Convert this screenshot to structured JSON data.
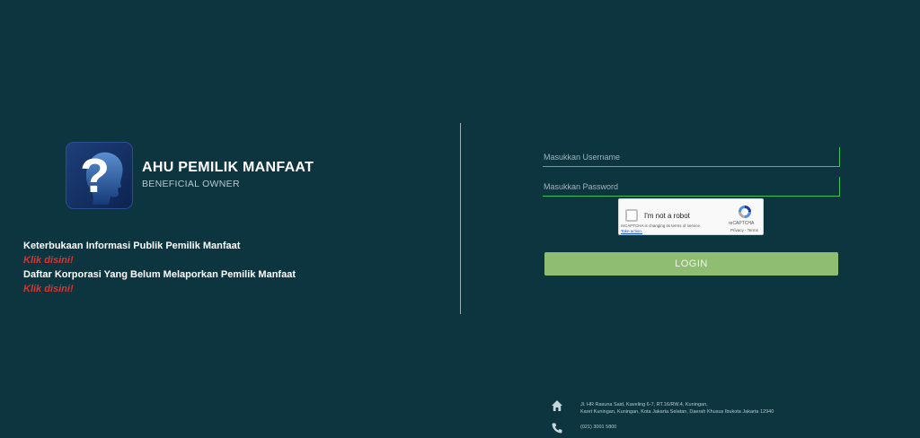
{
  "brand": {
    "title": "AHU PEMILIK MANFAAT",
    "subtitle": "BENEFICIAL OWNER",
    "logo_icon": "question-head-logo-icon"
  },
  "info": {
    "line1": "Keterbukaan Informasi Publik Pemilik Manfaat",
    "link1": "Klik disini!",
    "line2": "Daftar Korporasi Yang Belum Melaporkan Pemilik Manfaat",
    "link2": "Klik disini!"
  },
  "login": {
    "username_placeholder": "Masukkan Username",
    "username_value": "",
    "password_placeholder": "Masukkan Password",
    "password_value": "",
    "button_label": "LOGIN"
  },
  "recaptcha": {
    "label": "I'm not a robot",
    "note": "reCAPTCHA is changing its terms of service.",
    "action_link": "Take action.",
    "brand": "reCAPTCHA",
    "terms": "Privacy - Terms"
  },
  "footer": {
    "address_line1": "Jl. HR Rasuna Said, Kaveling 6-7, RT.16/RW.4, Kuningan,",
    "address_line2": "Karet Kuningan, Kuningan, Kota Jakarta Selatan, Daerah Khusus Ibukota Jakarta 12940",
    "phone": "(021) 3001 5800",
    "home_icon": "home-icon",
    "phone_icon": "phone-icon"
  },
  "colors": {
    "background": "#0c3540",
    "accent_green": "#3ec25e",
    "login_button": "#8fbe72",
    "link_red": "#e0322b"
  }
}
